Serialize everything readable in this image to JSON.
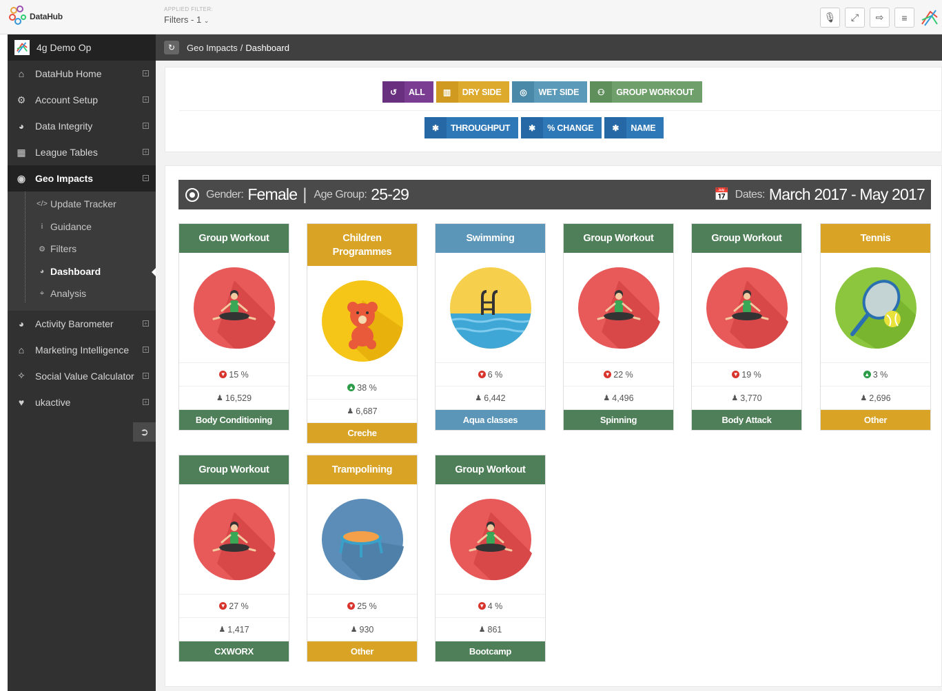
{
  "app": {
    "name": "DataHub"
  },
  "topbar": {
    "filter_caption": "APPLIED FILTER:",
    "filter_value": "Filters - 1",
    "actions": [
      {
        "icon": "microphone-icon",
        "glyph": "🎙"
      },
      {
        "icon": "fullscreen-icon",
        "glyph": "⤢"
      },
      {
        "icon": "logout-icon",
        "glyph": "⇨"
      },
      {
        "icon": "menu-icon",
        "glyph": "≡"
      }
    ]
  },
  "sidebar": {
    "org_name": "4g Demo Op",
    "items": [
      {
        "label": "DataHub Home",
        "icon": "home-icon",
        "glyph": "⌂"
      },
      {
        "label": "Account Setup",
        "icon": "gears-icon",
        "glyph": "⚙"
      },
      {
        "label": "Data Integrity",
        "icon": "dashboard-icon",
        "glyph": "◕"
      },
      {
        "label": "League Tables",
        "icon": "table-icon",
        "glyph": "▦"
      },
      {
        "label": "Geo Impacts",
        "icon": "globe-icon",
        "glyph": "◉"
      },
      {
        "label": "Activity Barometer",
        "icon": "dashboard-icon",
        "glyph": "◕"
      },
      {
        "label": "Marketing Intelligence",
        "icon": "bank-icon",
        "glyph": "⌂"
      },
      {
        "label": "Social Value Calculator",
        "icon": "magic-wand-icon",
        "glyph": "✧"
      },
      {
        "label": "ukactive",
        "icon": "heartbeat-icon",
        "glyph": "♥"
      }
    ],
    "sub_items": [
      {
        "label": "Update Tracker",
        "icon": "code-icon",
        "glyph": "</>"
      },
      {
        "label": "Guidance",
        "icon": "info-icon",
        "glyph": "i"
      },
      {
        "label": "Filters",
        "icon": "gears-icon",
        "glyph": "⚙"
      },
      {
        "label": "Dashboard",
        "icon": "dashboard-icon",
        "glyph": "◕"
      },
      {
        "label": "Analysis",
        "icon": "map-marker-icon",
        "glyph": "⌖"
      }
    ]
  },
  "breadcrumb": {
    "parent": "Geo Impacts",
    "separator": "/",
    "current": "Dashboard"
  },
  "filters": {
    "row1": [
      {
        "label": "ALL",
        "icon": "refresh-icon",
        "glyph": "↺",
        "color": "#7b3d91"
      },
      {
        "label": "DRY SIDE",
        "icon": "building-icon",
        "glyph": "▥",
        "color": "#ddaa2e"
      },
      {
        "label": "WET SIDE",
        "icon": "life-ring-icon",
        "glyph": "◎",
        "color": "#5b9ab9"
      },
      {
        "label": "GROUP WORKOUT",
        "icon": "users-icon",
        "glyph": "⚇",
        "color": "#6fa06c"
      }
    ],
    "row2": [
      {
        "label": "THROUGHPUT",
        "icon": "asterisk-icon",
        "glyph": "✱"
      },
      {
        "label": "% CHANGE",
        "icon": "asterisk-icon",
        "glyph": "✱"
      },
      {
        "label": "NAME",
        "icon": "asterisk-icon",
        "glyph": "✱"
      }
    ]
  },
  "results": {
    "gender_label": "Gender:",
    "gender_value": "Female",
    "age_label": "Age Group:",
    "age_value": "25-29",
    "dates_label": "Dates:",
    "dates_value": "March 2017 - May 2017"
  },
  "cards": [
    {
      "title": "Group Workout",
      "image": "yoga",
      "direction": "down",
      "change": "15 %",
      "count": "16,529",
      "footer": "Body Conditioning",
      "theme": "green"
    },
    {
      "title": "Children Programmes",
      "image": "teddy",
      "direction": "up",
      "change": "38 %",
      "count": "6,687",
      "footer": "Creche",
      "theme": "gold"
    },
    {
      "title": "Swimming",
      "image": "pool",
      "direction": "down",
      "change": "6 %",
      "count": "6,442",
      "footer": "Aqua classes",
      "theme": "blue"
    },
    {
      "title": "Group Workout",
      "image": "yoga",
      "direction": "down",
      "change": "22 %",
      "count": "4,496",
      "footer": "Spinning",
      "theme": "green"
    },
    {
      "title": "Group Workout",
      "image": "yoga",
      "direction": "down",
      "change": "19 %",
      "count": "3,770",
      "footer": "Body Attack",
      "theme": "green"
    },
    {
      "title": "Tennis",
      "image": "tennis",
      "direction": "up",
      "change": "3 %",
      "count": "2,696",
      "footer": "Other",
      "theme": "gold"
    },
    {
      "title": "Group Workout",
      "image": "yoga",
      "direction": "down",
      "change": "27 %",
      "count": "1,417",
      "footer": "CXWORX",
      "theme": "green"
    },
    {
      "title": "Trampolining",
      "image": "trampoline",
      "direction": "down",
      "change": "25 %",
      "count": "930",
      "footer": "Other",
      "theme": "gold"
    },
    {
      "title": "Group Workout",
      "image": "yoga",
      "direction": "down",
      "change": "4 %",
      "count": "861",
      "footer": "Bootcamp",
      "theme": "green"
    }
  ]
}
